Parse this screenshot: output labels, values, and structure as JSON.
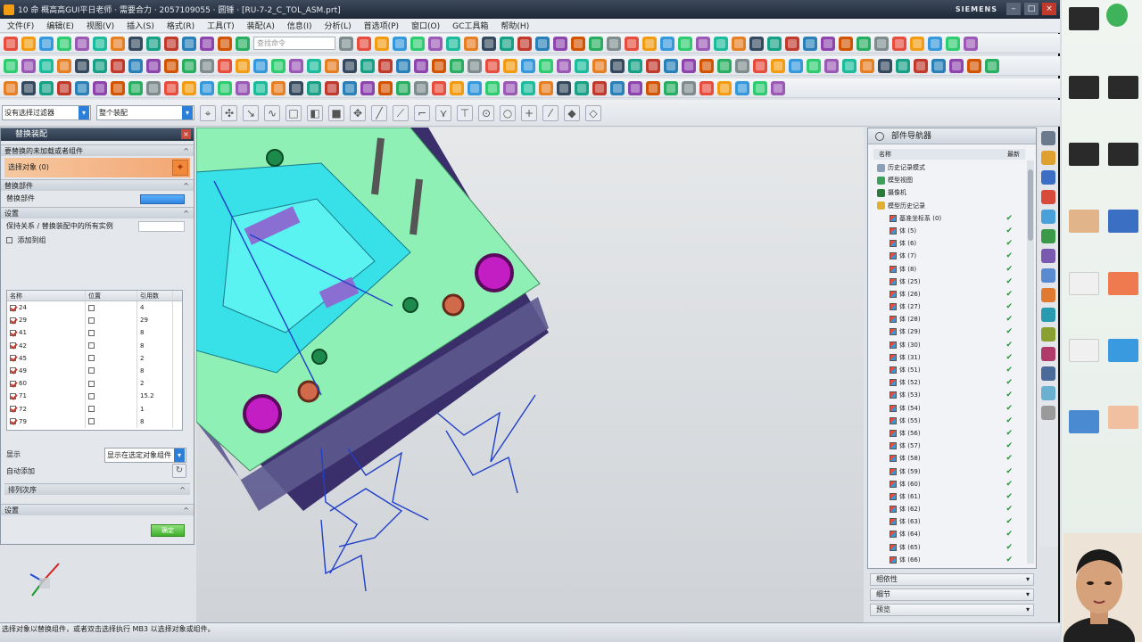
{
  "window": {
    "title": "10 命 概高高GUI平日老师 · 需要合力 · 2057109055 · 圆锤 · [RU-7-2_C_TOL_ASM.prt]",
    "brand": "SIEMENS",
    "min_label": "–",
    "max_label": "□",
    "close_label": "×"
  },
  "menu": {
    "items": [
      "文件(F)",
      "编辑(E)",
      "视图(V)",
      "插入(S)",
      "格式(R)",
      "工具(T)",
      "装配(A)",
      "信息(I)",
      "分析(L)",
      "首选项(P)",
      "窗口(O)",
      "GC工具箱",
      "帮助(H)"
    ]
  },
  "toolbar": {
    "search_placeholder": "查找命令"
  },
  "selection_bar": {
    "filter_value": "没有选择过滤器",
    "scope_value": "整个装配"
  },
  "dialog": {
    "title": "替换装配",
    "sections": {
      "component": "要替换的未加载或者组件",
      "selected": "选择对象 (0)",
      "replacement": "替换部件",
      "replacement_row": "替换部件",
      "settings": "设置",
      "settings_row": "保持关系 / 替换装配中的所有实例",
      "checkbox_label": "添加到组",
      "list_title": "名称",
      "option_label": "显示",
      "option_value": "显示在选定对象组件",
      "auto_label": "自动添加",
      "filter_label": "排列次序",
      "bottom_section": "设置"
    },
    "grid": {
      "headers": [
        "名称",
        "位置",
        "引用数"
      ],
      "rows": [
        {
          "name": "24",
          "ref": "4"
        },
        {
          "name": "29",
          "ref": "29"
        },
        {
          "name": "41",
          "ref": "8"
        },
        {
          "name": "42",
          "ref": "8"
        },
        {
          "name": "45",
          "ref": "2"
        },
        {
          "name": "49",
          "ref": "8"
        },
        {
          "name": "60",
          "ref": "2"
        },
        {
          "name": "71",
          "ref": "15.2"
        },
        {
          "name": "72",
          "ref": "1"
        },
        {
          "name": "79",
          "ref": "8"
        }
      ]
    },
    "ok_label": "确定"
  },
  "navigator": {
    "title": "部件导航器",
    "col_name": "名称",
    "col_status": "最新",
    "nodes": [
      {
        "label": "历史记录模式",
        "level": 0,
        "type": "mode",
        "check": false
      },
      {
        "label": "模型视图",
        "level": 0,
        "type": "view",
        "check": false
      },
      {
        "label": "摄像机",
        "level": 0,
        "type": "camera",
        "check": false
      },
      {
        "label": "模型历史记录",
        "level": 0,
        "type": "history",
        "check": false
      },
      {
        "label": "基准坐标系 (0)",
        "level": 1,
        "type": "feat",
        "check": true
      },
      {
        "label": "体 (5)",
        "level": 1,
        "type": "feat",
        "check": true
      },
      {
        "label": "体 (6)",
        "level": 1,
        "type": "feat",
        "check": true
      },
      {
        "label": "体 (7)",
        "level": 1,
        "type": "feat",
        "check": true
      },
      {
        "label": "体 (8)",
        "level": 1,
        "type": "feat",
        "check": true
      },
      {
        "label": "体 (25)",
        "level": 1,
        "type": "feat",
        "check": true
      },
      {
        "label": "体 (26)",
        "level": 1,
        "type": "feat",
        "check": true
      },
      {
        "label": "体 (27)",
        "level": 1,
        "type": "feat",
        "check": true
      },
      {
        "label": "体 (28)",
        "level": 1,
        "type": "feat",
        "check": true
      },
      {
        "label": "体 (29)",
        "level": 1,
        "type": "feat",
        "check": true
      },
      {
        "label": "体 (30)",
        "level": 1,
        "type": "feat",
        "check": true
      },
      {
        "label": "体 (31)",
        "level": 1,
        "type": "feat",
        "check": true
      },
      {
        "label": "体 (51)",
        "level": 1,
        "type": "feat",
        "check": true
      },
      {
        "label": "体 (52)",
        "level": 1,
        "type": "feat",
        "check": true
      },
      {
        "label": "体 (53)",
        "level": 1,
        "type": "feat",
        "check": true
      },
      {
        "label": "体 (54)",
        "level": 1,
        "type": "feat",
        "check": true
      },
      {
        "label": "体 (55)",
        "level": 1,
        "type": "feat",
        "check": true
      },
      {
        "label": "体 (56)",
        "level": 1,
        "type": "feat",
        "check": true
      },
      {
        "label": "体 (57)",
        "level": 1,
        "type": "feat",
        "check": true
      },
      {
        "label": "体 (58)",
        "level": 1,
        "type": "feat",
        "check": true
      },
      {
        "label": "体 (59)",
        "level": 1,
        "type": "feat",
        "check": true
      },
      {
        "label": "体 (60)",
        "level": 1,
        "type": "feat",
        "check": true
      },
      {
        "label": "体 (61)",
        "level": 1,
        "type": "feat",
        "check": true
      },
      {
        "label": "体 (62)",
        "level": 1,
        "type": "feat",
        "check": true
      },
      {
        "label": "体 (63)",
        "level": 1,
        "type": "feat",
        "check": true
      },
      {
        "label": "体 (64)",
        "level": 1,
        "type": "feat",
        "check": true
      },
      {
        "label": "体 (65)",
        "level": 1,
        "type": "feat",
        "check": true
      },
      {
        "label": "体 (66)",
        "level": 1,
        "type": "feat",
        "check": true
      }
    ],
    "panels": [
      "相依性",
      "细节",
      "预览"
    ]
  },
  "statusbar": {
    "text": "选择对象以替换组件，或者双击选择执行 MB3 以选择对象或组件。"
  }
}
